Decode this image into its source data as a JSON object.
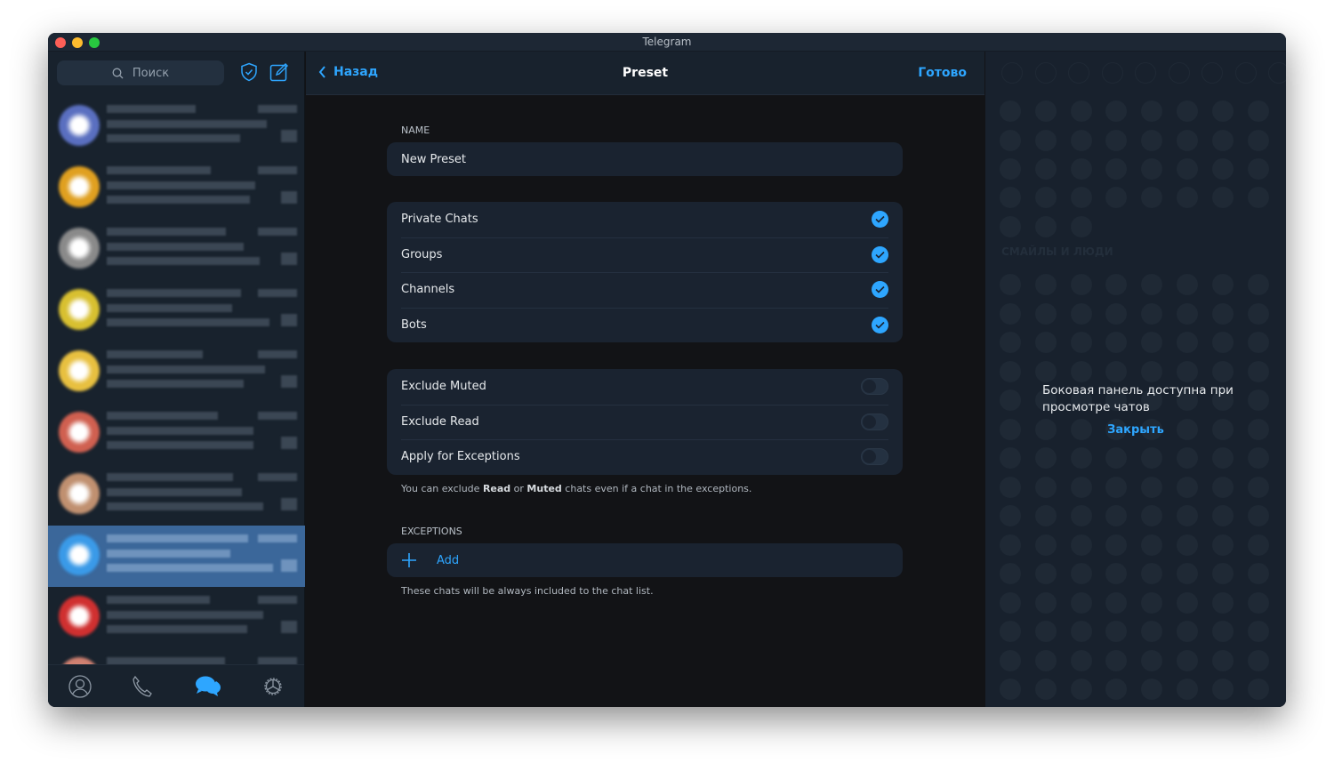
{
  "window": {
    "title": "Telegram",
    "traffic_lights": [
      "#fe5f57",
      "#febc2e",
      "#28c840"
    ]
  },
  "colors": {
    "accent": "#2ea6ff",
    "card": "#1a2330",
    "background": "#121316"
  },
  "sidebar": {
    "search_placeholder": "Поиск",
    "icons": [
      "shield-check-icon",
      "compose-icon"
    ],
    "chats_selected_index": 7,
    "tabs": [
      {
        "name": "contacts",
        "icon": "person-icon",
        "active": false
      },
      {
        "name": "calls",
        "icon": "phone-icon",
        "active": false
      },
      {
        "name": "chats",
        "icon": "chat-bubbles-icon",
        "active": true
      },
      {
        "name": "settings",
        "icon": "gear-icon",
        "active": false
      }
    ]
  },
  "header": {
    "back_label": "Назад",
    "title": "Preset",
    "done_label": "Готово"
  },
  "name_section": {
    "label": "NAME",
    "value": "New Preset"
  },
  "include": [
    {
      "label": "Private Chats",
      "checked": true
    },
    {
      "label": "Groups",
      "checked": true
    },
    {
      "label": "Channels",
      "checked": true
    },
    {
      "label": "Bots",
      "checked": true
    }
  ],
  "exclude": [
    {
      "label": "Exclude Muted",
      "on": false
    },
    {
      "label": "Exclude Read",
      "on": false
    },
    {
      "label": "Apply for Exceptions",
      "on": false
    }
  ],
  "exclude_note": {
    "p1": "You can exclude ",
    "b1": "Read",
    "p2": " or ",
    "b2": "Muted",
    "p3": " chats even if a chat in the exceptions."
  },
  "exceptions": {
    "label": "EXCEPTIONS",
    "add_label": "Add",
    "note": "These chats will be always included to the chat list."
  },
  "right_panel": {
    "message": "Боковая панель доступна при просмотре чатов",
    "close_label": "Закрыть",
    "category_label": "СМАЙЛЫ И ЛЮДИ"
  }
}
